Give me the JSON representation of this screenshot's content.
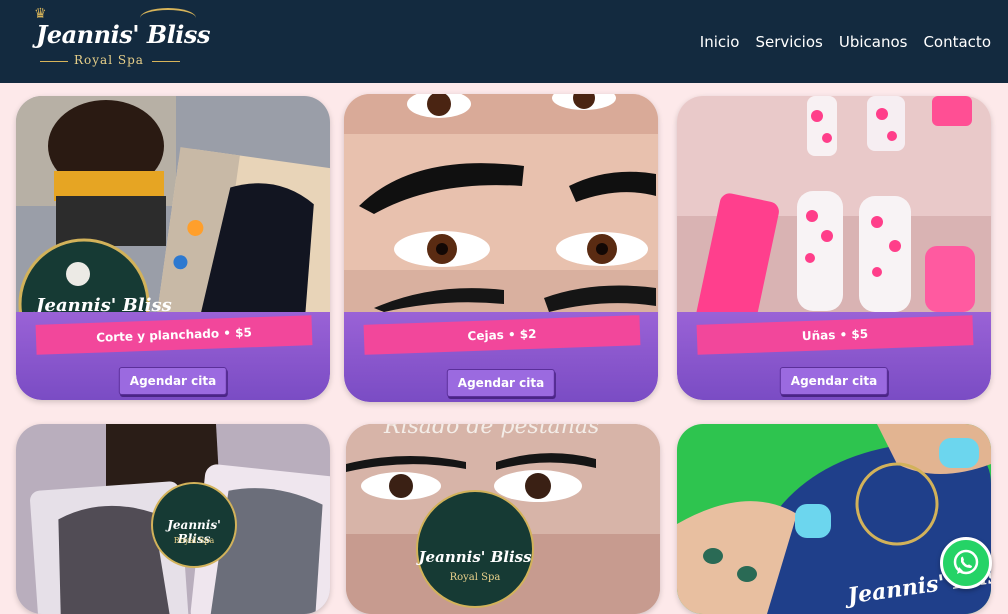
{
  "header": {
    "brand": "Jeannis' Bliss",
    "brand_sub": "Royal Spa",
    "nav": [
      "Inicio",
      "Servicios",
      "Ubicanos",
      "Contacto"
    ]
  },
  "services": [
    {
      "title": "Corte y planchado • $5",
      "button": "Agendar cita"
    },
    {
      "title": "Cejas • $2",
      "button": "Agendar cita"
    },
    {
      "title": "Uñas • $5",
      "button": "Agendar cita"
    }
  ],
  "row2": {
    "overlay_text": "Risado de pestañas",
    "seal_brand": "Jeannis' Bliss",
    "seal_sub": "Royal Spa",
    "foot_brand": "Jeannis' Bliss"
  },
  "colors": {
    "header": "#132a3f",
    "background": "#fde9ea",
    "panel": "#8a56cf",
    "ribbon": "#f2479b",
    "whatsapp": "#25d366"
  },
  "icons": [
    "crown-icon",
    "whatsapp-icon"
  ]
}
